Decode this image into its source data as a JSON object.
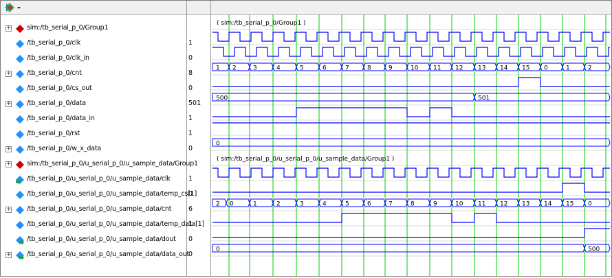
{
  "toolbar": {
    "icon": "wave-diamond-dropdown-icon"
  },
  "signals": [
    {
      "name": "sim:/tb_serial_p_0/Group1",
      "value": "",
      "kind": "group",
      "expandable": true,
      "icon": "group-diamond-icon"
    },
    {
      "name": "/tb_serial_p_0/clk",
      "value": "1",
      "kind": "clock",
      "expandable": false,
      "icon": "signal-diamond-icon"
    },
    {
      "name": "/tb_serial_p_0/clk_in",
      "value": "0",
      "kind": "clock",
      "expandable": false,
      "icon": "signal-diamond-icon"
    },
    {
      "name": "/tb_serial_p_0/cnt",
      "value": "8",
      "kind": "bus",
      "expandable": true,
      "icon": "signal-diamond-icon"
    },
    {
      "name": "/tb_serial_p_0/cs_out",
      "value": "0",
      "kind": "bit",
      "expandable": false,
      "icon": "signal-diamond-icon"
    },
    {
      "name": "/tb_serial_p_0/data",
      "value": "501",
      "kind": "bus",
      "expandable": true,
      "icon": "signal-diamond-icon"
    },
    {
      "name": "/tb_serial_p_0/data_in",
      "value": "1",
      "kind": "bit",
      "expandable": false,
      "icon": "signal-diamond-icon"
    },
    {
      "name": "/tb_serial_p_0/rst",
      "value": "1",
      "kind": "bit",
      "expandable": false,
      "icon": "signal-diamond-icon"
    },
    {
      "name": "/tb_serial_p_0/w_x_data",
      "value": "0",
      "kind": "bus",
      "expandable": true,
      "icon": "signal-diamond-icon"
    },
    {
      "name": "sim:/tb_serial_p_0/u_serial_p_0/u_sample_data/Group1",
      "value": "",
      "kind": "group",
      "expandable": true,
      "icon": "group-diamond-icon"
    },
    {
      "name": "/tb_serial_p_0/u_serial_p_0/u_sample_data/clk",
      "value": "1",
      "kind": "clock",
      "expandable": false,
      "icon": "port-in-icon"
    },
    {
      "name": "/tb_serial_p_0/u_serial_p_0/u_sample_data/temp_cs[1]",
      "value": "0",
      "kind": "bit",
      "expandable": false,
      "icon": "signal-diamond-icon"
    },
    {
      "name": "/tb_serial_p_0/u_serial_p_0/u_sample_data/cnt",
      "value": "6",
      "kind": "bus",
      "expandable": true,
      "icon": "signal-diamond-icon"
    },
    {
      "name": "/tb_serial_p_0/u_serial_p_0/u_sample_data/temp_data[1]",
      "value": "1",
      "kind": "bit",
      "expandable": false,
      "icon": "signal-diamond-icon"
    },
    {
      "name": "/tb_serial_p_0/u_serial_p_0/u_sample_data/dout",
      "value": "0",
      "kind": "bit",
      "expandable": false,
      "icon": "port-out-icon"
    },
    {
      "name": "/tb_serial_p_0/u_serial_p_0/u_sample_data/data_out",
      "value": "0",
      "kind": "bus",
      "expandable": true,
      "icon": "port-out-icon"
    }
  ],
  "waves": {
    "group1_label": "( sim:/tb_serial_p_0/Group1 )",
    "group2_label": "( sim:/tb_serial_p_0/u_serial_p_0/u_sample_data/Group1 )",
    "cnt_values": [
      "1",
      "2",
      "3",
      "4",
      "5",
      "6",
      "7",
      "8",
      "9",
      "10",
      "11",
      "12",
      "13",
      "14",
      "15",
      "0",
      "1",
      "2"
    ],
    "data_values": [
      "500",
      "501"
    ],
    "w_x_data_values": [
      "0"
    ],
    "sample_cnt_values": [
      "2",
      "0",
      "1",
      "2",
      "3",
      "4",
      "5",
      "6",
      "7",
      "8",
      "9",
      "10",
      "11",
      "12",
      "13",
      "14",
      "15",
      "0"
    ],
    "data_out_values": [
      "0",
      "500"
    ],
    "colors": {
      "wave": "#0000ff",
      "cursor": "#00cc00",
      "group_marker": "#cc0000",
      "signal_marker": "#1e90ff"
    }
  }
}
